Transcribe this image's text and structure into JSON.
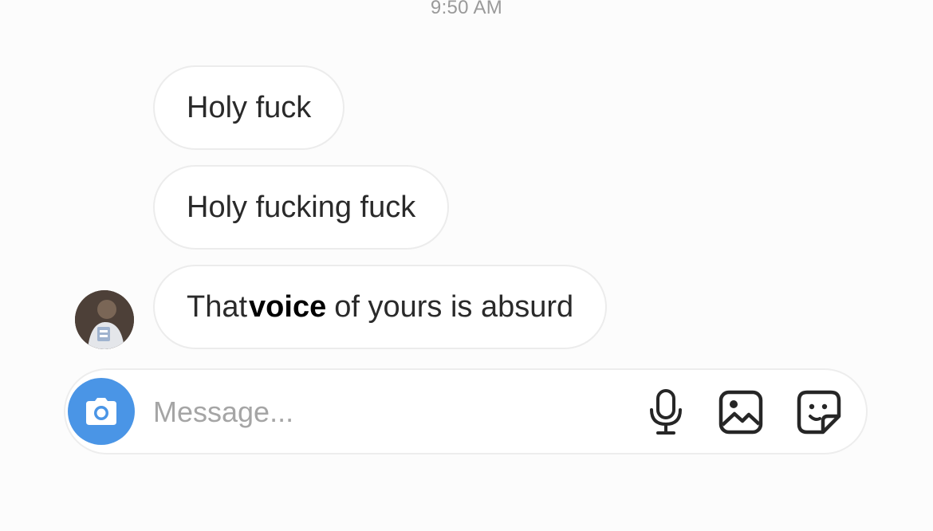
{
  "header": {
    "timestamp": "9:50 AM"
  },
  "messages": [
    {
      "text": "Holy fuck"
    },
    {
      "text": "Holy fucking fuck"
    },
    {
      "prefix": "That",
      "highlight": "voice",
      "suffix": "of yours is absurd"
    }
  ],
  "composer": {
    "placeholder": "Message...",
    "value": "",
    "camera_icon": "camera-icon",
    "mic_icon": "microphone-icon",
    "gallery_icon": "gallery-icon",
    "sticker_icon": "sticker-icon",
    "accent_color": "#4a95e6"
  }
}
